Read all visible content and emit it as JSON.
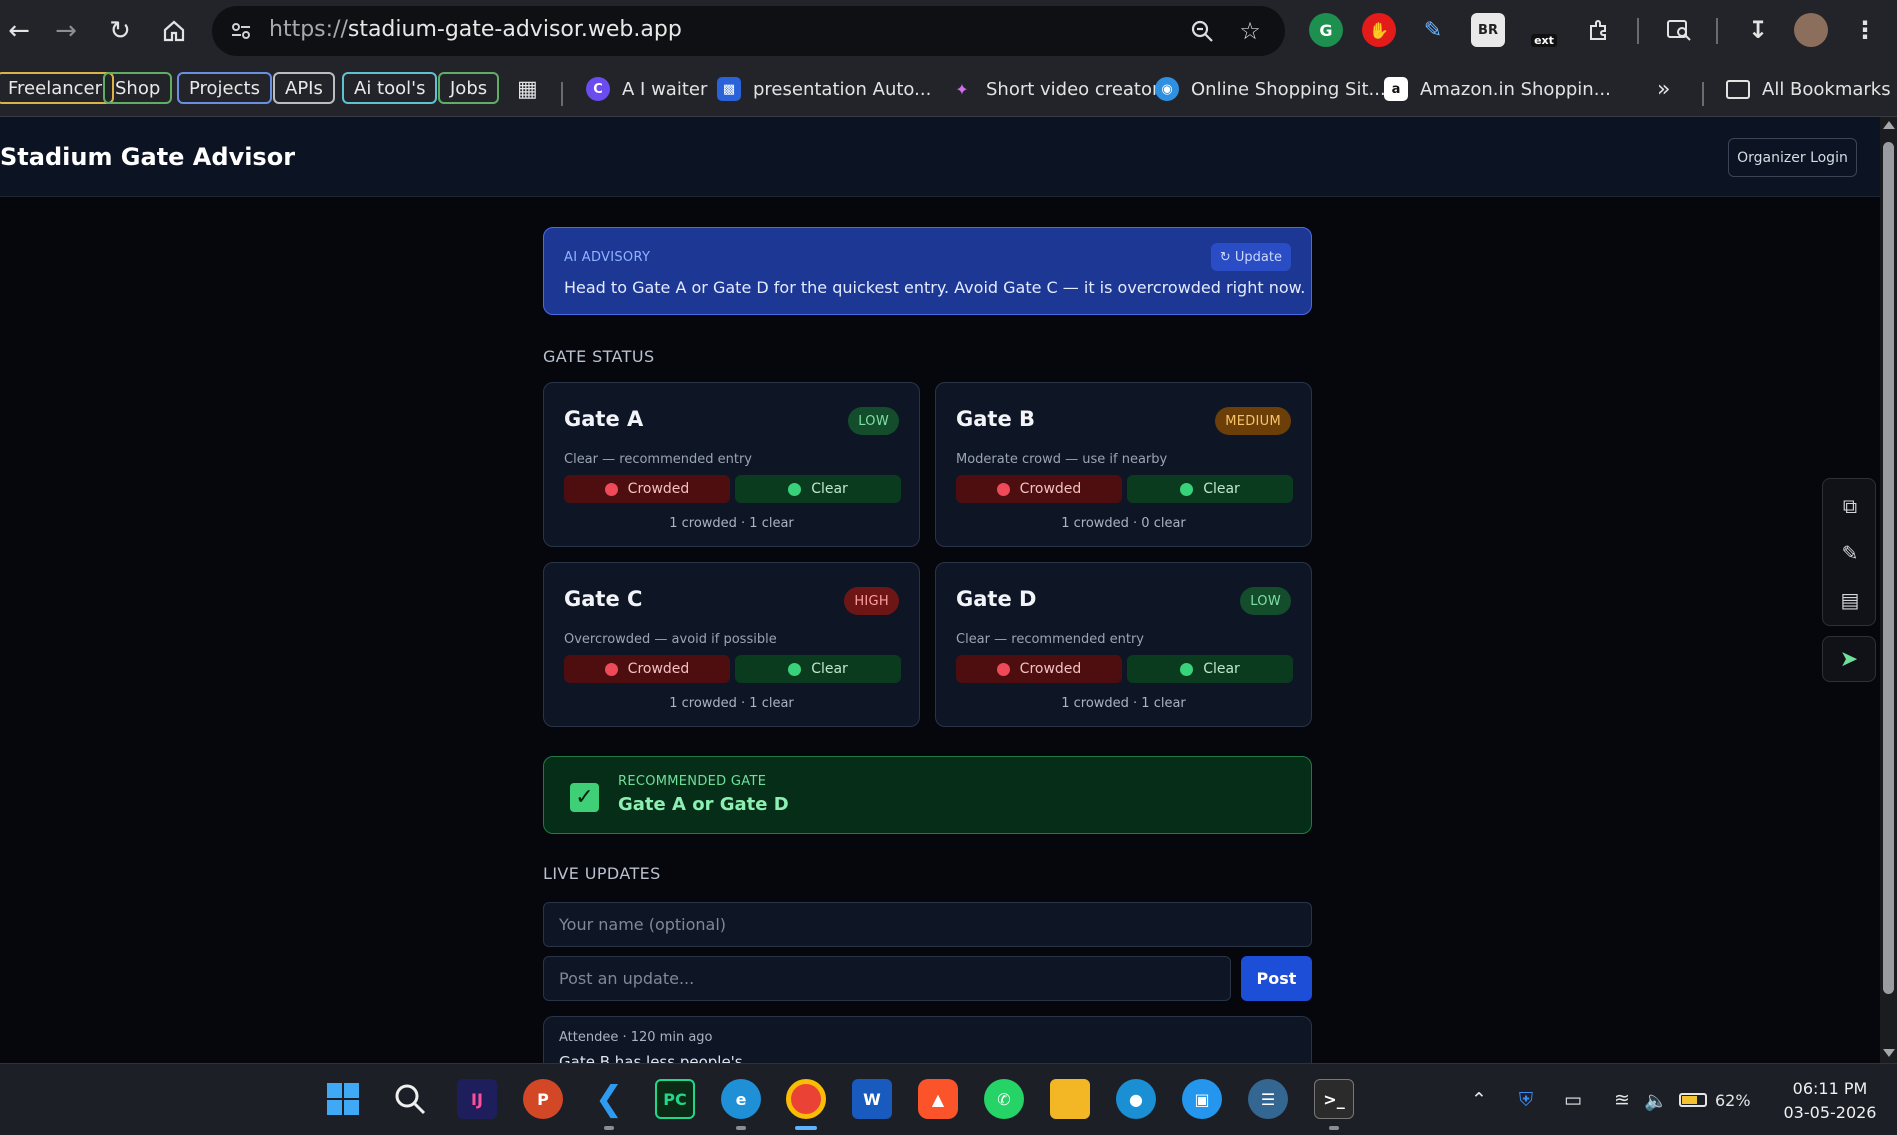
{
  "browser": {
    "url_scheme": "https://",
    "url_host": "stadium-gate-advisor.web.app",
    "extensions": {
      "br_label": "BR",
      "ext_label": "ext"
    },
    "bookmarks_chips": [
      "Freelancer",
      "Shop",
      "Projects",
      "APIs",
      "Ai tool's",
      "Jobs"
    ],
    "bookmarks": [
      {
        "label": "A I waiter",
        "icon": "C"
      },
      {
        "label": "presentation Auto...",
        "icon": ""
      },
      {
        "label": "Short video creator",
        "icon": ""
      },
      {
        "label": "Online Shopping Sit...",
        "icon": ""
      },
      {
        "label": "Amazon.in Shoppin...",
        "icon": "a"
      }
    ],
    "overflow_label": "»",
    "all_bookmarks_label": "All Bookmarks"
  },
  "header": {
    "title": "Stadium Gate Advisor",
    "organizer_button": "Organizer Login"
  },
  "advisory": {
    "label": "AI ADVISORY",
    "update_button": "↻ Update",
    "text": "Head to Gate A or Gate D for the quickest entry. Avoid Gate C — it is overcrowded right now."
  },
  "gate_status": {
    "heading": "GATE STATUS",
    "gates": [
      {
        "name": "Gate A",
        "level": "LOW",
        "level_kind": "low",
        "description": "Clear — recommended entry",
        "crowded_label": "Crowded",
        "clear_label": "Clear",
        "counts": "1 crowded · 1 clear"
      },
      {
        "name": "Gate B",
        "level": "MEDIUM",
        "level_kind": "medium",
        "description": "Moderate crowd — use if nearby",
        "crowded_label": "Crowded",
        "clear_label": "Clear",
        "counts": "1 crowded · 0 clear"
      },
      {
        "name": "Gate C",
        "level": "HIGH",
        "level_kind": "high",
        "description": "Overcrowded — avoid if possible",
        "crowded_label": "Crowded",
        "clear_label": "Clear",
        "counts": "1 crowded · 1 clear"
      },
      {
        "name": "Gate D",
        "level": "LOW",
        "level_kind": "low",
        "description": "Clear — recommended entry",
        "crowded_label": "Crowded",
        "clear_label": "Clear",
        "counts": "1 crowded · 1 clear"
      }
    ]
  },
  "recommended": {
    "label": "RECOMMENDED GATE",
    "value": "Gate A or Gate D"
  },
  "live_updates": {
    "heading": "LIVE UPDATES",
    "name_placeholder": "Your name (optional)",
    "update_placeholder": "Post an update...",
    "post_button": "Post",
    "items": [
      {
        "meta": "Attendee · 120 min ago",
        "message": "Gate B has less people's"
      }
    ]
  },
  "taskbar": {
    "battery": "62%",
    "time": "06:11 PM",
    "date": "03-05-2026"
  },
  "colors": {
    "page_bg": "#05070d",
    "card_bg": "#0e1626",
    "advisory_bg": "#1d3794",
    "recommended_bg": "#062d17",
    "primary": "#1d4ed8",
    "low": "#134d2c",
    "medium": "#6b3f07",
    "high": "#6e1616"
  }
}
